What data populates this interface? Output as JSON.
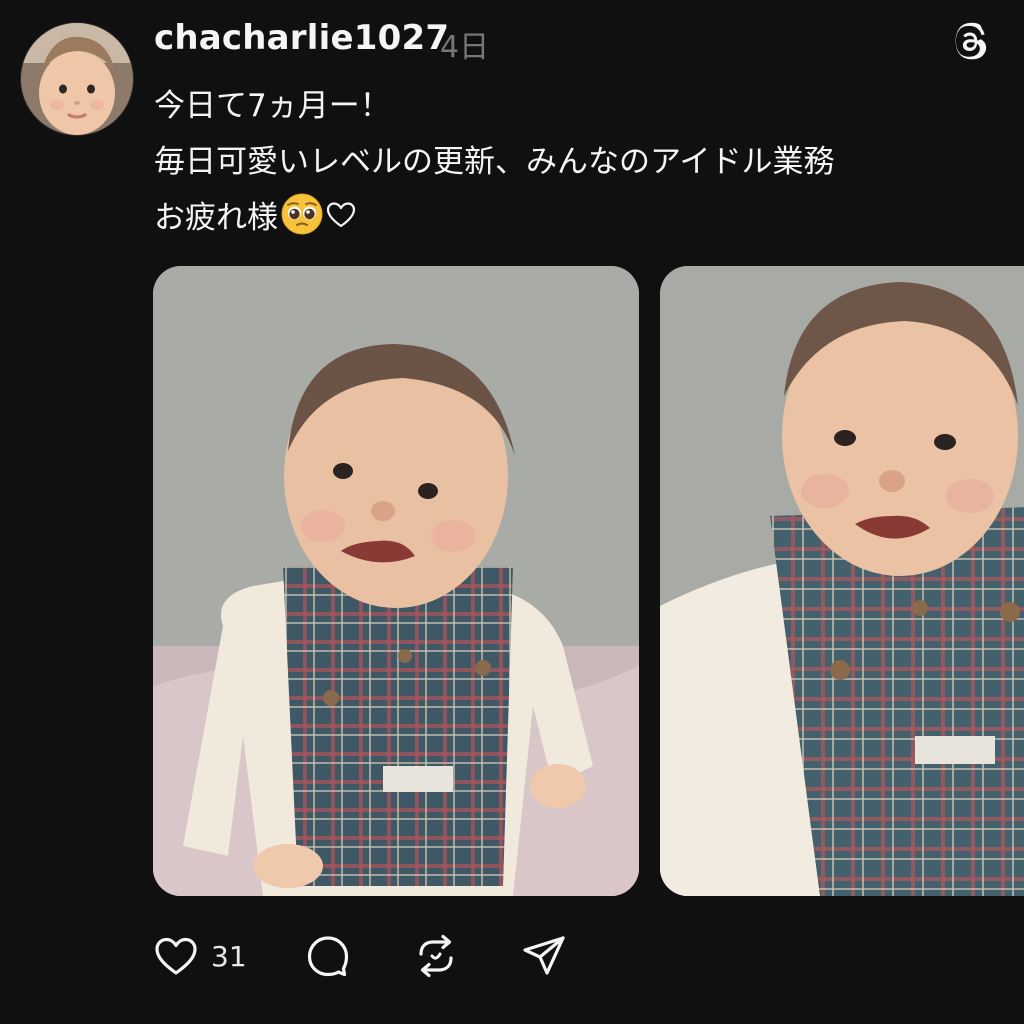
{
  "post": {
    "username": "chacharlie1027",
    "time": "4日",
    "caption": {
      "line1": "今日て7ヵ月ー！",
      "line2": "毎日可愛いレベルの更新、みんなのアイドル業務",
      "line3": "お疲れ様",
      "emoji": "pleading-face-emoji",
      "heart": "♡"
    },
    "images": [
      {
        "name": "baby-photo-1",
        "icon": "photo"
      },
      {
        "name": "baby-photo-2",
        "icon": "photo"
      }
    ],
    "actions": {
      "like_count": "31",
      "like_icon": "heart-icon",
      "reply_icon": "comment-icon",
      "repost_icon": "repost-icon",
      "share_icon": "send-icon"
    }
  },
  "colors": {
    "background": "#101010",
    "text": "#f3f5f7",
    "secondary_text": "#777777"
  }
}
